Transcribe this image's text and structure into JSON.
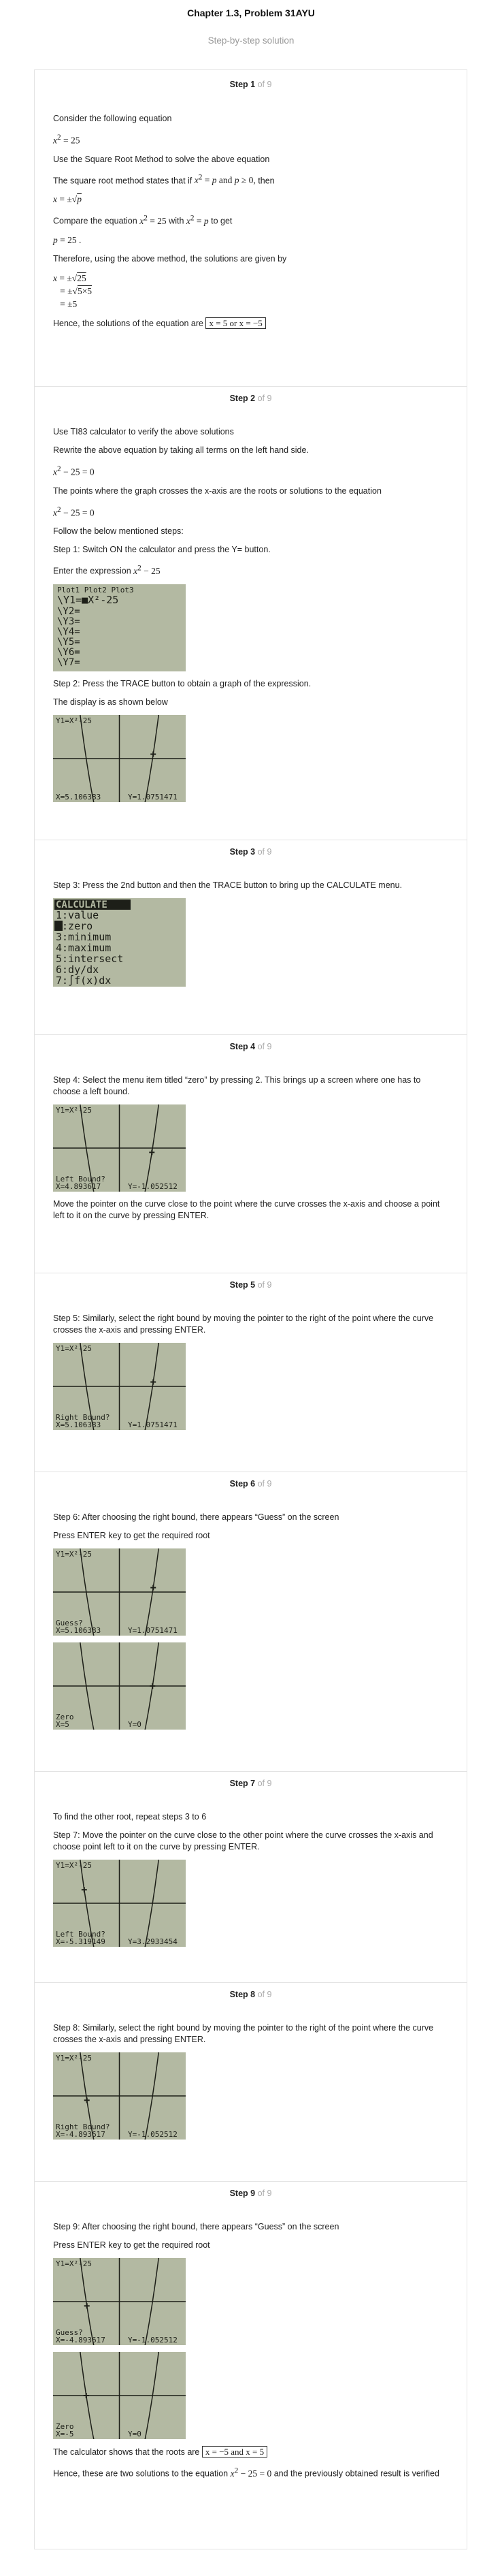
{
  "header": {
    "title": "Chapter 1.3, Problem 31AYU",
    "subtitle": "Step-by-step solution"
  },
  "steps": [
    {
      "num": "Step 1",
      "of": "of 9"
    },
    {
      "num": "Step 2",
      "of": "of 9"
    },
    {
      "num": "Step 3",
      "of": "of 9"
    },
    {
      "num": "Step 4",
      "of": "of 9"
    },
    {
      "num": "Step 5",
      "of": "of 9"
    },
    {
      "num": "Step 6",
      "of": "of 9"
    },
    {
      "num": "Step 7",
      "of": "of 9"
    },
    {
      "num": "Step 8",
      "of": "of 9"
    },
    {
      "num": "Step 9",
      "of": "of 9"
    }
  ],
  "s1": {
    "t1": "Consider the following equation",
    "t2": "Use the Square Root Method to solve the above equation",
    "t3a": "The square root method states that if",
    "t3b": "then",
    "t4a": "Compare the equation",
    "t4b": "with",
    "t4c": "to get",
    "t5": "Therefore, using the above method, the solutions are given by",
    "t6": "Hence, the solutions of the equation are",
    "answer": "x = 5 or x = −5"
  },
  "s2": {
    "t1": "Use TI83 calculator to verify the above solutions",
    "t2": "Rewrite the above equation by taking all terms on the left hand side.",
    "t3": "The points where the graph crosses the x-axis are the roots or solutions to the equation",
    "t4": "Follow the below mentioned steps:",
    "t5": "Step 1: Switch ON the calculator and press the Y= button.",
    "t6": "Enter the expression",
    "t7": "Step 2: Press the TRACE button to obtain a graph of the expression.",
    "t8": "The display is as shown below",
    "ylist_top": "Plot1  Plot2  Plot3",
    "ylist": [
      "\\Y1=■X²-25",
      "\\Y2=",
      "\\Y3=",
      "\\Y4=",
      "\\Y5=",
      "\\Y6=",
      "\\Y7="
    ],
    "graph": {
      "top": "Y1=X²-25",
      "bl": "X=5.106383",
      "br": "Y=1.0751471"
    }
  },
  "s3": {
    "t1": "Step 3: Press the 2nd button and then the TRACE button to bring up the CALCULATE menu.",
    "menu": [
      "CALCULATE",
      "1:value",
      "2:zero",
      "3:minimum",
      "4:maximum",
      "5:intersect",
      "6:dy/dx",
      "7:∫f(x)dx"
    ]
  },
  "s4": {
    "t1": "Step 4: Select the menu item titled “zero” by pressing 2. This brings up a screen where one has to choose a left bound.",
    "t2": "Move the pointer on the curve close to the point where the curve crosses the x-axis and choose a point left to it on the curve by pressing ENTER.",
    "graph": {
      "top": "Y1=X²-25",
      "mid": "Left Bound?",
      "bl": "X=4.893617",
      "br": "Y=-1.052512"
    }
  },
  "s5": {
    "t1": "Step 5: Similarly, select the right bound by moving the pointer to the right of the point where the curve crosses the x-axis and pressing ENTER.",
    "graph": {
      "top": "Y1=X²-25",
      "mid": "Right Bound?",
      "bl": "X=5.106383",
      "br": "Y=1.0751471"
    }
  },
  "s6": {
    "t1": "Step 6: After choosing the right bound, there appears “Guess” on the screen",
    "t2": "Press ENTER key to get the required root",
    "graph1": {
      "top": "Y1=X²-25",
      "mid": "Guess?",
      "bl": "X=5.106383",
      "br": "Y=1.0751471"
    },
    "graph2": {
      "mid": "Zero",
      "bl": "X=5",
      "br": "Y=0"
    }
  },
  "s7": {
    "t1": "To find the other root, repeat steps 3 to 6",
    "t2": "Step 7: Move the pointer on the curve close to the other point where the curve crosses the x-axis and choose point left to it on the curve by pressing ENTER.",
    "graph": {
      "top": "Y1=X²-25",
      "mid": "Left Bound?",
      "bl": "X=-5.319149",
      "br": "Y=3.2933454"
    }
  },
  "s8": {
    "t1": "Step 8: Similarly, select the right bound by moving the pointer to the right of the point where the curve crosses the x-axis and pressing ENTER.",
    "graph": {
      "top": "Y1=X²-25",
      "mid": "Right Bound?",
      "bl": "X=-4.893617",
      "br": "Y=-1.052512"
    }
  },
  "s9": {
    "t1": "Step 9: After choosing the right bound, there appears “Guess” on the screen",
    "t2": "Press ENTER key to get the required root",
    "graph1": {
      "top": "Y1=X²-25",
      "mid": "Guess?",
      "bl": "X=-4.893617",
      "br": "Y=-1.052512"
    },
    "graph2": {
      "mid": "Zero",
      "bl": "X=-5",
      "br": "Y=0"
    },
    "t3": "The calculator shows that the roots are",
    "answer": "x = −5 and x = 5",
    "t4a": "Hence, these are two solutions to the equation",
    "t4b": "and the previously obtained result is verified"
  },
  "colors": {
    "screen": "#b3b9a2",
    "ink": "#1d1f18",
    "border": "#e3e3e3",
    "muted": "#999999"
  }
}
